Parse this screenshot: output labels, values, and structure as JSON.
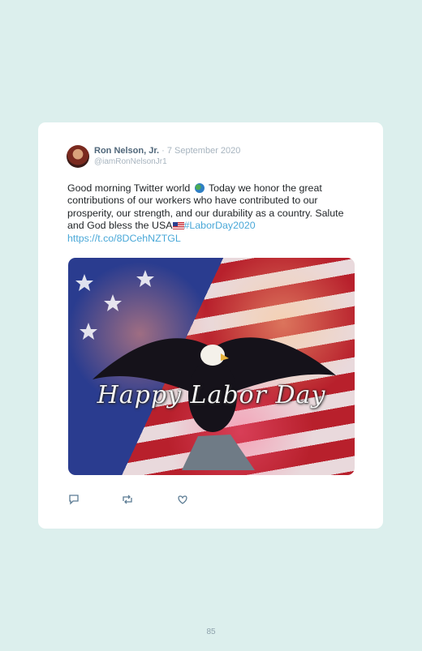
{
  "tweet": {
    "author_name": "Ron Nelson, Jr.",
    "separator": "·",
    "date": "7 September 2020",
    "handle": "@iamRonNelsonJr1",
    "text_part1": "Good morning Twitter world",
    "text_part2": "Today we honor the great contributions of our workers who have contributed to our prosperity, our strength, and our durability as a country. Salute and God bless the USA",
    "hashtag": "#LaborDay2020",
    "link": "https://t.co/8DCehNZTGL",
    "media_caption": "Happy Labor Day",
    "icons": [
      "reply-icon",
      "retweet-icon",
      "like-icon",
      "globe-emoji",
      "us-flag-emoji"
    ]
  },
  "page": {
    "number": "85"
  }
}
